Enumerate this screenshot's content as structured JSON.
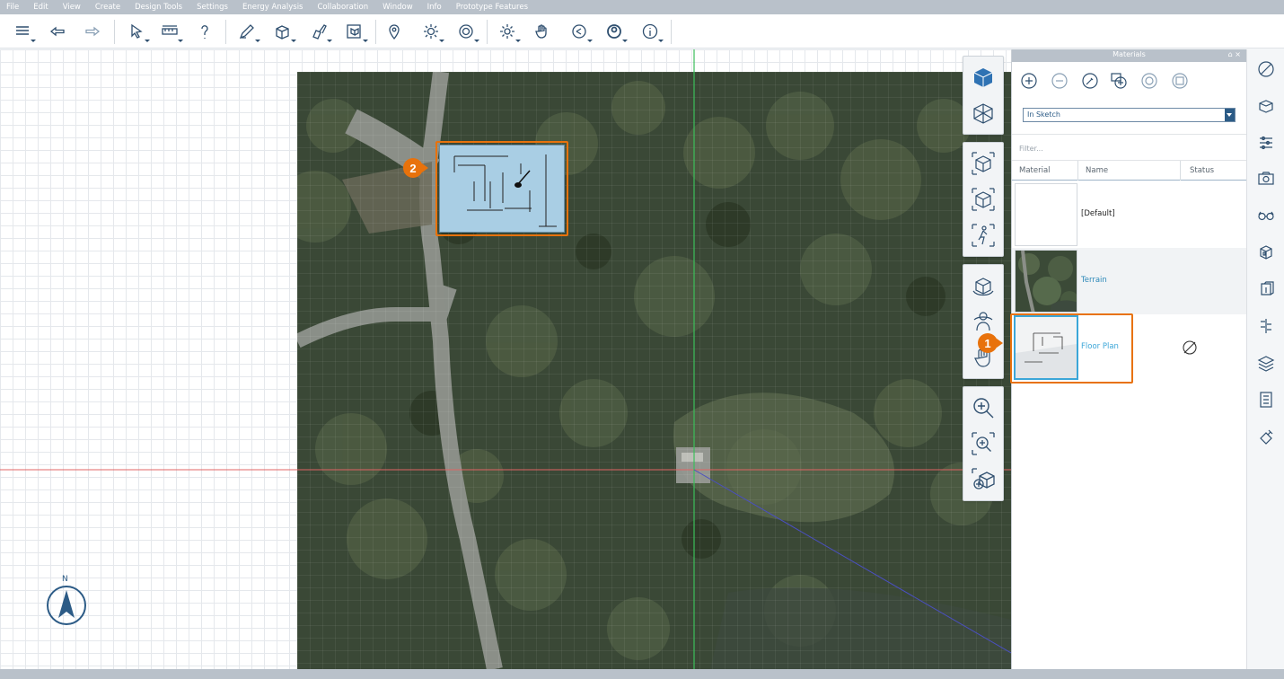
{
  "menu": {
    "items": [
      "File",
      "Edit",
      "View",
      "Create",
      "Design Tools",
      "Settings",
      "Energy Analysis",
      "Collaboration",
      "Window",
      "Info",
      "Prototype Features"
    ]
  },
  "toolbar": {
    "icons": [
      "layers-menu-icon",
      "undo-icon",
      "redo-icon",
      "select-tool-icon",
      "measure-tool-icon",
      "help-lightbulb-icon",
      "sketch-tool-icon",
      "push-pull-icon",
      "paint-material-icon",
      "import-object-icon",
      "location-pin-icon",
      "sun-settings-icon",
      "rendering-icon",
      "gear-settings-icon",
      "hand-pan-icon",
      "share-icon",
      "user-profile-icon",
      "info-icon"
    ]
  },
  "materials_panel": {
    "title": "Materials",
    "pin_label": "⌂ ×",
    "filter_scope": "In Sketch",
    "filter_placeholder": "Filter...",
    "columns": {
      "material": "Material",
      "name": "Name",
      "status": "Status"
    },
    "rows": [
      {
        "name": "[Default]",
        "selected": false,
        "status": ""
      },
      {
        "name": "Terrain",
        "selected": false,
        "status": ""
      },
      {
        "name": "Floor Plan",
        "selected": true,
        "status": "not-used-icon"
      }
    ]
  },
  "callouts": {
    "one": "1",
    "two": "2"
  },
  "compass": {
    "label": "N"
  },
  "colors": {
    "accent": "#e8720c",
    "selected_text": "#3ba6d8",
    "link_text": "#2c88b8",
    "panel_header": "#b9c1ca",
    "x_axis": "#e06464",
    "y_axis": "#3cbf5a",
    "z_axis": "#4a4fc0"
  }
}
